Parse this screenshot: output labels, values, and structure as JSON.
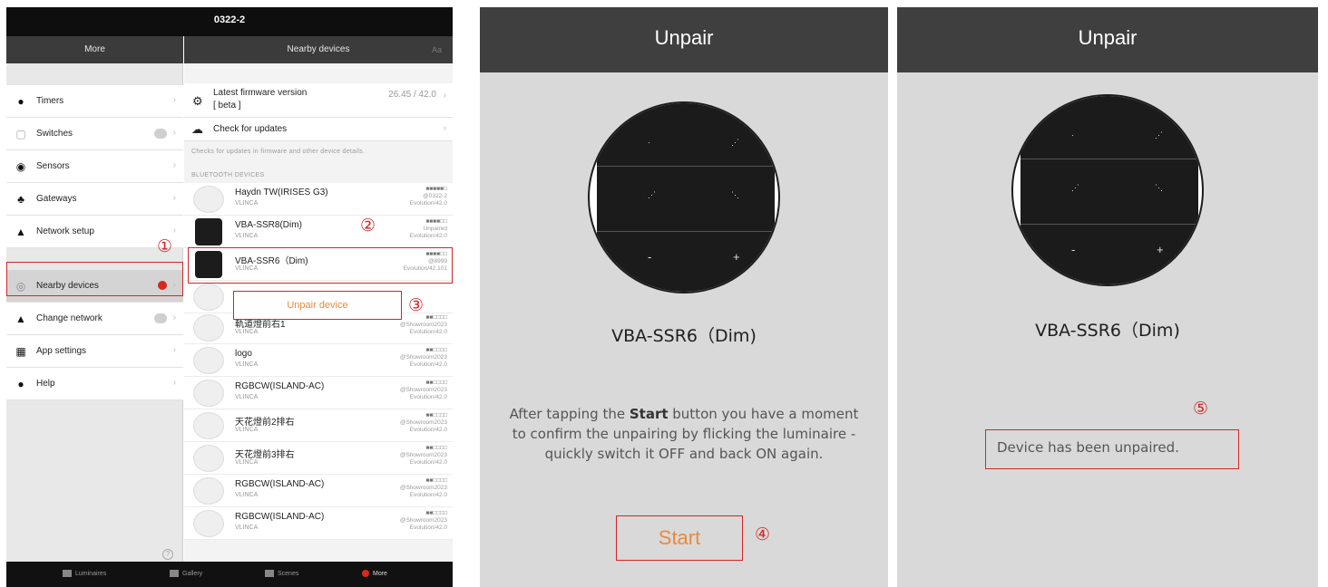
{
  "app": {
    "device_title": "0322-2",
    "left_nav_title": "More",
    "right_nav_title": "Nearby devices",
    "right_nav_action": "Aa"
  },
  "menu": [
    {
      "label": "Timers",
      "icon": "clock-icon"
    },
    {
      "label": "Switches",
      "icon": "switch-icon"
    },
    {
      "label": "Sensors",
      "icon": "sensor-icon"
    },
    {
      "label": "Gateways",
      "icon": "gateway-icon"
    },
    {
      "label": "Network setup",
      "icon": "network-icon"
    },
    {
      "label": "Nearby devices",
      "icon": "nearby-icon"
    },
    {
      "label": "Change network",
      "icon": "network-icon"
    },
    {
      "label": "App settings",
      "icon": "settings-grid-icon"
    },
    {
      "label": "Help",
      "icon": "info-icon"
    }
  ],
  "firmware": {
    "label": "Latest firmware version",
    "sublabel": "[ beta ]",
    "value": "26.45 / 42.0",
    "check_label": "Check for updates",
    "note": "Checks for updates in firmware and other device details.",
    "section_header": "BLUETOOTH DEVICES"
  },
  "devices": [
    {
      "name": "Haydn TW(IRISES G3)",
      "brand": "VLINCA",
      "status": [
        "■■■■■□",
        "@0322-2",
        "Evolution/42.0"
      ]
    },
    {
      "name": "VBA-SSR8(Dim)",
      "brand": "VLINCA",
      "status": [
        "■■■■□□",
        "Unpaired",
        "Evolution/42.0"
      ]
    },
    {
      "name": "VBA-SSR6（Dim)",
      "brand": "VLINCA",
      "status": [
        "■■■■□□",
        "@8999",
        "Evolution/42.101"
      ]
    },
    {
      "name": "軌道燈前右1",
      "brand": "VLINCA",
      "status": [
        "■■□□□□",
        "@Showroom2023",
        "Evolution/42.0"
      ]
    },
    {
      "name": "logo",
      "brand": "VLINCA",
      "status": [
        "■■□□□□",
        "@Showroom2023",
        "Evolution/42.0"
      ]
    },
    {
      "name": "RGBCW(ISLAND-AC)",
      "brand": "VLINCA",
      "status": [
        "■■□□□□",
        "@Showroom2023",
        "Evolution/42.0"
      ]
    },
    {
      "name": "天花燈前2排右",
      "brand": "VLINCA",
      "status": [
        "■■□□□□",
        "@Showroom2023",
        "Evolution/42.0"
      ]
    },
    {
      "name": "天花燈前3排右",
      "brand": "VLINCA",
      "status": [
        "■■□□□□",
        "@Showroom2023",
        "Evolution/42.0"
      ]
    },
    {
      "name": "RGBCW(ISLAND-AC)",
      "brand": "VLINCA",
      "status": [
        "■■□□□□",
        "@Showroom2023",
        "Evolution/42.0"
      ]
    },
    {
      "name": "RGBCW(ISLAND-AC)",
      "brand": "VLINCA",
      "status": [
        "■■□□□□",
        "@Showroom2023",
        "Evolution/42.0"
      ]
    }
  ],
  "popup": {
    "unpair_label": "Unpair device"
  },
  "tabs": [
    {
      "label": "Luminaires",
      "icon": "lamp-icon"
    },
    {
      "label": "Gallery",
      "icon": "gallery-icon"
    },
    {
      "label": "Scenes",
      "icon": "scenes-icon"
    },
    {
      "label": "More",
      "icon": "more-icon"
    }
  ],
  "unpair_screen": {
    "title": "Unpair",
    "device_name": "VBA-SSR6（Dim)",
    "description_prefix": "After tapping the ",
    "description_bold": "Start",
    "description_suffix": " button you have a moment to confirm the unpairing by flicking the luminaire - quickly switch it OFF and back ON again.",
    "start_label": "Start",
    "switch_symbols": [
      "-",
      "+"
    ]
  },
  "unpaired_screen": {
    "title": "Unpair",
    "device_name": "VBA-SSR6（Dim)",
    "message": "Device has been unpaired."
  },
  "steps": [
    "①",
    "②",
    "③",
    "④",
    "⑤"
  ],
  "colors": {
    "accent": "#e98a3b",
    "callout": "#d32626",
    "header": "#3f3f3f",
    "badge": "#d8291a"
  }
}
